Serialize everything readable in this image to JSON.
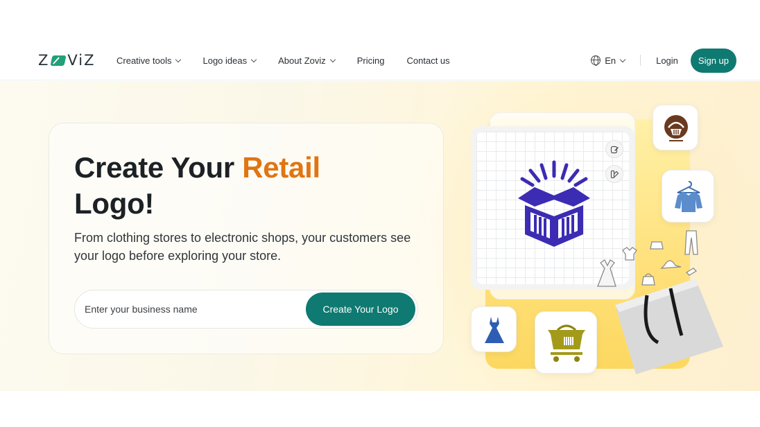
{
  "brand": {
    "logo_text_left": "Z",
    "logo_text_right": "ViZ"
  },
  "nav": {
    "items": [
      {
        "label": "Creative tools",
        "has_dropdown": true
      },
      {
        "label": "Logo ideas",
        "has_dropdown": true
      },
      {
        "label": "About Zoviz",
        "has_dropdown": true
      },
      {
        "label": "Pricing",
        "has_dropdown": false
      },
      {
        "label": "Contact us",
        "has_dropdown": false
      }
    ],
    "language": "En",
    "login": "Login",
    "signup": "Sign up"
  },
  "hero": {
    "title_part1": "Create Your ",
    "title_accent": "Retail",
    "title_part2": "Logo!",
    "subtitle": "From clothing stores to electronic shops, your customers see your logo before exploring your store.",
    "input_placeholder": "Enter your business name",
    "cta": "Create Your Logo"
  },
  "icons": [
    "globe-icon",
    "edit-icon",
    "palette-icon",
    "box-logo-icon",
    "basket-icon",
    "shirt-hanger-icon",
    "dress-icon",
    "shopping-cart-icon",
    "shopping-bag-icon"
  ],
  "colors": {
    "brand_teal": "#0f7a71",
    "accent_orange": "#e07512",
    "logo_green": "#21a07a",
    "box_logo_purple": "#3b2cb3",
    "yellow_panel": "#ffe07a"
  }
}
